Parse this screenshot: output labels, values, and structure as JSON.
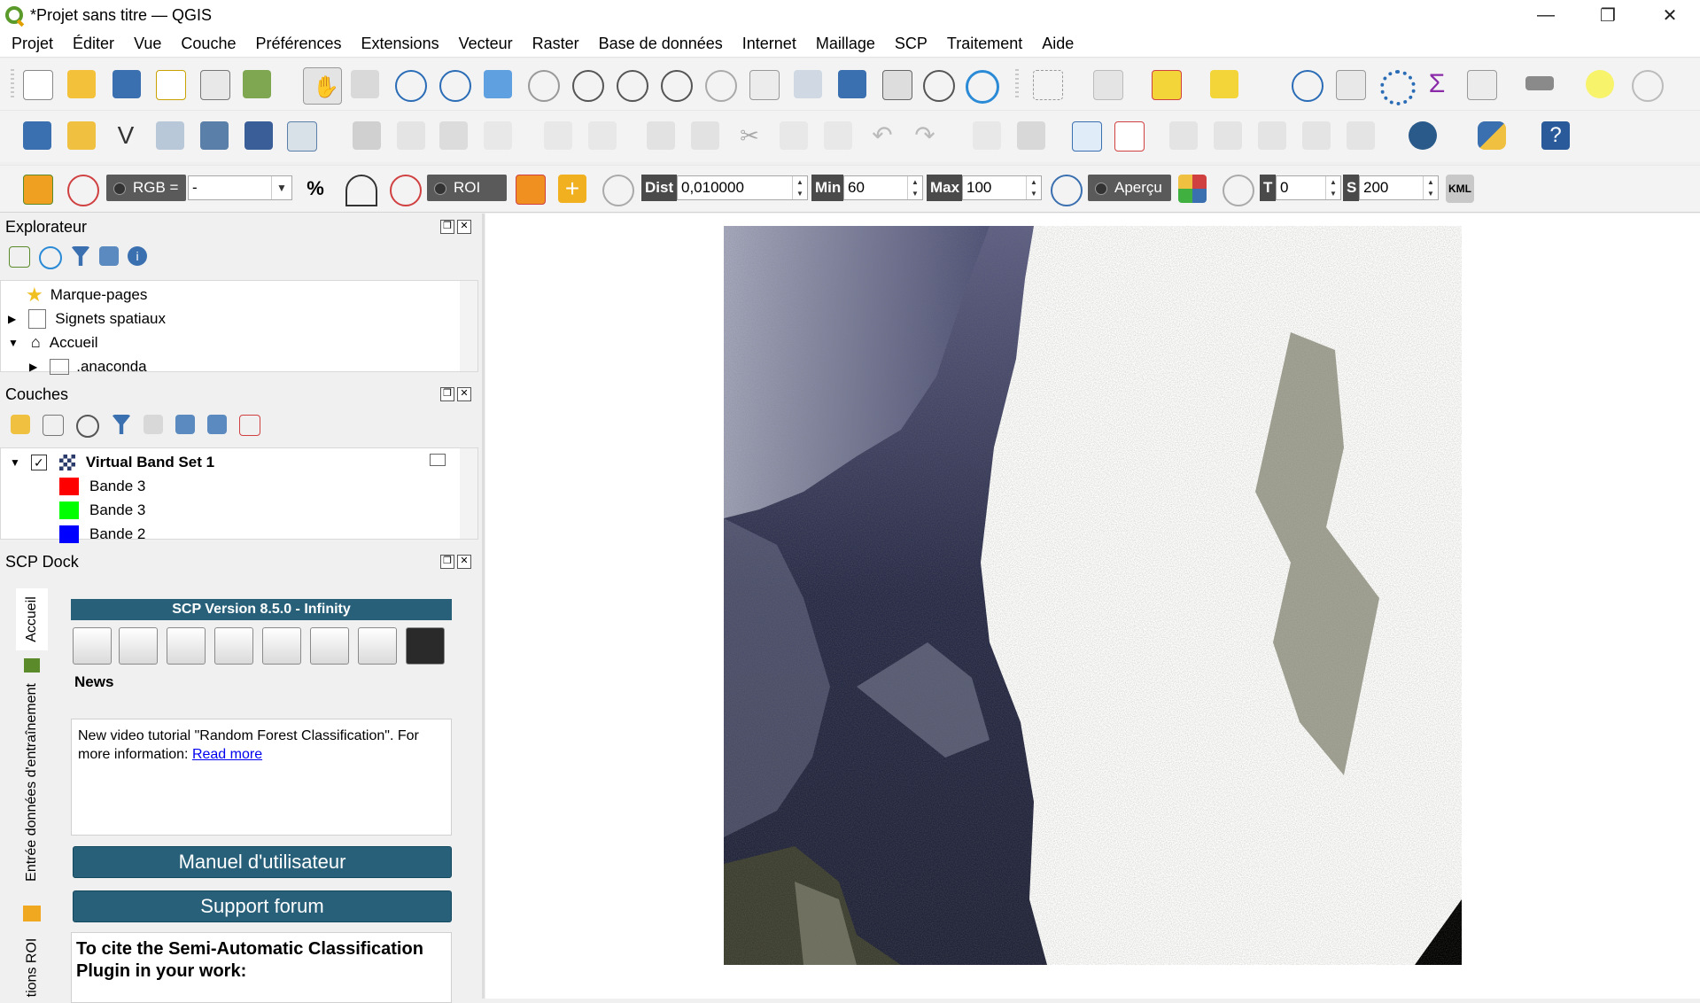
{
  "window": {
    "title": "*Projet sans titre — QGIS",
    "minimize": "—",
    "maximize": "❐",
    "close": "✕"
  },
  "menu": [
    "Projet",
    "Éditer",
    "Vue",
    "Couche",
    "Préférences",
    "Extensions",
    "Vecteur",
    "Raster",
    "Base de données",
    "Internet",
    "Maillage",
    "SCP",
    "Traitement",
    "Aide"
  ],
  "scp_toolbar": {
    "rgb_label": "RGB =",
    "rgb_value": "-",
    "roi_label": "ROI",
    "dist_label": "Dist",
    "dist_value": "0,010000",
    "min_label": "Min",
    "min_value": "60",
    "max_label": "Max",
    "max_value": "100",
    "preview_label": "Aperçu",
    "t_label": "T",
    "t_value": "0",
    "s_label": "S",
    "s_value": "200",
    "kml_label": "KML"
  },
  "browser": {
    "title": "Explorateur",
    "items": [
      {
        "label": "Marque-pages"
      },
      {
        "label": "Signets spatiaux"
      },
      {
        "label": "Accueil"
      },
      {
        "label": ".anaconda"
      }
    ]
  },
  "layers": {
    "title": "Couches",
    "group": "Virtual Band Set  1",
    "bands": [
      {
        "label": "Bande 3",
        "color": "#ff0000"
      },
      {
        "label": "Bande 3",
        "color": "#00ff00"
      },
      {
        "label": "Bande 2",
        "color": "#0000ff"
      }
    ]
  },
  "scp_dock": {
    "title": "SCP Dock",
    "version": "SCP Version 8.5.0 - Infinity",
    "tabs": [
      "Accueil",
      "Entrée données d'entraînement",
      "tions ROI"
    ],
    "news_title": "News",
    "news_text": "New video tutorial \"Random Forest Classification\". For more information: ",
    "news_link": "Read more",
    "manual_button": "Manuel d'utilisateur",
    "forum_button": "Support forum",
    "cite_text": "To cite the Semi-Automatic Classification Plugin in your work:"
  },
  "colors": {
    "scp_accent": "#28607a",
    "toolbar_bg": "#f3f3f3"
  }
}
